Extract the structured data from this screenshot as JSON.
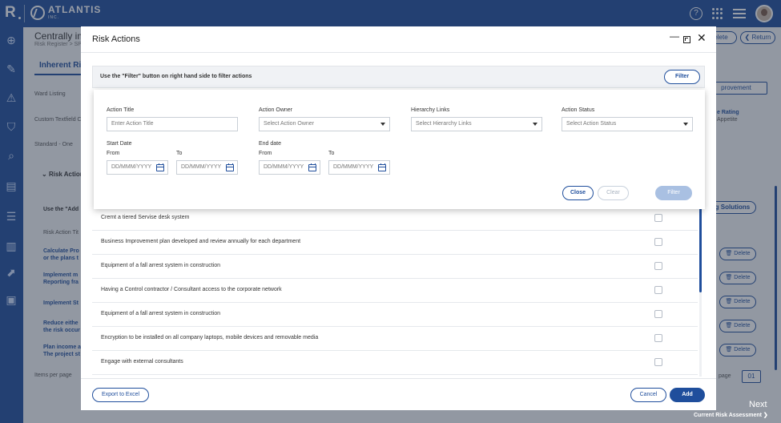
{
  "topbar": {
    "logo": "R",
    "brand_name": "ATLANTIS",
    "brand_sub": "INC."
  },
  "background": {
    "title": "Centrally im",
    "breadcrumb": "Risk Register > SP",
    "tab": "Inherent Risk",
    "labels": [
      "Ward Listing",
      "Custom Textfield C",
      "Standard - One"
    ],
    "risk_actions": "Risk Action",
    "use_the_add": "Use the \"Add",
    "risk_action_title": "Risk Action Tit",
    "left_rows": [
      {
        "l1": "Calculate Pro",
        "l2": "or the plans t"
      },
      {
        "l1": "Implement m",
        "l2": "Reporting fra"
      },
      {
        "l1": "Implement St",
        "l2": ""
      },
      {
        "l1": "Reduce eithe",
        "l2": "the risk occur"
      },
      {
        "l1": "Plan income a",
        "l2": "The project st"
      }
    ],
    "items_per_page": "Items per page",
    "page_label": "page",
    "page_value": "01",
    "delete_btn": "elete",
    "return_btn": "Return",
    "improvement": "provement",
    "rating": "e Rating",
    "appetite": "Appetite",
    "solutions": "ng Solutions",
    "delete_label": "Delete",
    "next": "Next",
    "current_risk": "Current Risk Assessment"
  },
  "modal": {
    "title": "Risk Actions",
    "filter_hint": "Use the \"Filter\" button on right hand side to filter actions",
    "filter_btn": "Filter",
    "fields": {
      "action_title": {
        "label": "Action Title",
        "placeholder": "Enter Action Title"
      },
      "action_owner": {
        "label": "Action Owner",
        "placeholder": "Select Action Owner"
      },
      "hierarchy_links": {
        "label": "Hierarchy Links",
        "placeholder": "Select Hierarchy Links"
      },
      "action_status": {
        "label": "Action Status",
        "placeholder": "Select Action Status"
      },
      "start_date": {
        "label": "Start Date",
        "from": "From",
        "to": "To",
        "placeholder": "DD/MMM/YYYY"
      },
      "end_date": {
        "label": "End date",
        "from": "From",
        "to": "To",
        "placeholder": "DD/MMM/YYYY"
      }
    },
    "panel_buttons": {
      "close": "Close",
      "clear": "Clear",
      "filter": "Filter"
    },
    "actions": [
      "Cremt a tiered Servise desk system",
      "Business Improvement plan developed and review annually for each department",
      "Equipment of a fall arrest system in construction",
      "Having a Control contractor / Consultant access to the corporate network",
      "Equipment of a fall arrest system in construction",
      "Encryption to be installed on all company laptops, mobile devices and removable media",
      "Engage with external consultants"
    ],
    "footer": {
      "export": "Export to Excel",
      "cancel": "Cancel",
      "add": "Add"
    }
  }
}
